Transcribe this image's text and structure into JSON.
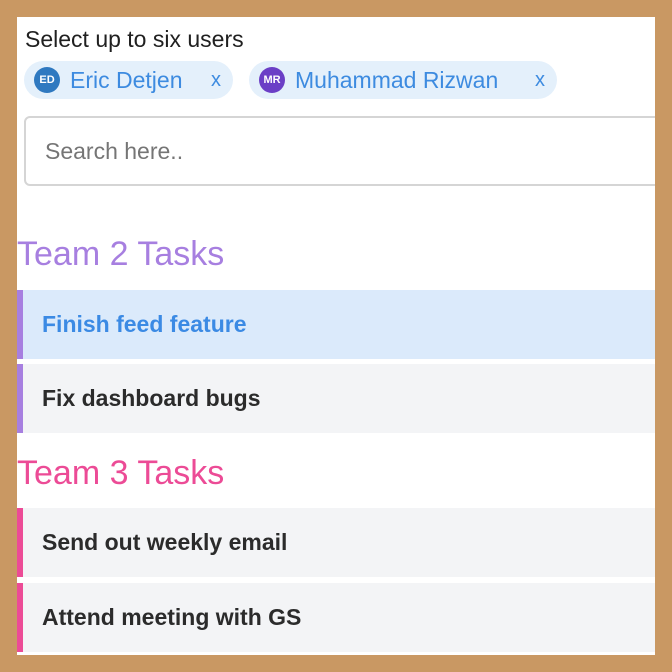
{
  "colors": {
    "team2_accent": "#a77fe0",
    "team3_accent": "#ec4b96",
    "chip_text": "#3d8be0",
    "chip_background": "#e4f0fb",
    "selected_task_background": "#dbeafb"
  },
  "user_picker": {
    "label": "Select up to six users",
    "selected_users": [
      {
        "initials": "ED",
        "name": "Eric Detjen",
        "avatar_color": "#2f79c0",
        "remove_label": "x"
      },
      {
        "initials": "MR",
        "name": "Muhammad Rizwan",
        "avatar_color": "#6b3fc6",
        "remove_label": "x"
      }
    ],
    "search": {
      "placeholder": "Search here..",
      "value": ""
    }
  },
  "task_groups": [
    {
      "title": "Team 2 Tasks",
      "tasks": [
        {
          "label": "Finish feed feature",
          "selected": true
        },
        {
          "label": "Fix dashboard bugs",
          "selected": false
        }
      ]
    },
    {
      "title": "Team 3 Tasks",
      "tasks": [
        {
          "label": "Send out weekly email",
          "selected": false
        },
        {
          "label": "Attend meeting with GS",
          "selected": false
        }
      ]
    }
  ]
}
